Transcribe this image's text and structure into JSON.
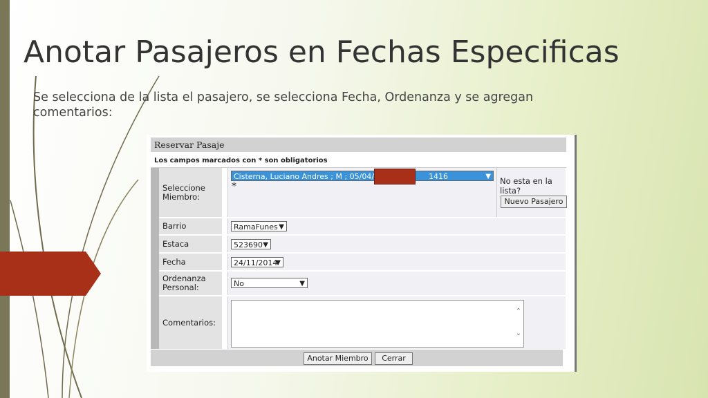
{
  "slide": {
    "title": "Anotar Pasajeros en Fechas Especificas",
    "body_line1": "Se selecciona de la lista el pasajero, se selecciona Fecha, Ordenanza y se agregan",
    "body_line2": "comentarios:"
  },
  "form": {
    "header": "Reservar Pasaje",
    "note": "Los campos marcados con * son obligatorios",
    "member": {
      "label": "Seleccione Miembro:",
      "value_left": "Cisterna, Luciano Andres ; M ; 05/04/1977 ;",
      "value_right": "1416",
      "required_mark": "*",
      "not_listed": "No esta en la lista?",
      "new_button": "Nuevo Pasajero"
    },
    "barrio": {
      "label": "Barrio",
      "value": "RamaFunes"
    },
    "estaca": {
      "label": "Estaca",
      "value": "523690"
    },
    "fecha": {
      "label": "Fecha",
      "value": "24/11/2014"
    },
    "ordenanza": {
      "label": "Ordenanza Personal:",
      "value": "No"
    },
    "comentarios": {
      "label": "Comentarios:",
      "value": ""
    },
    "buttons": {
      "submit": "Anotar Miembro",
      "cancel": "Cerrar"
    }
  },
  "colors": {
    "accent_red": "#a83018",
    "left_bar": "#7a7658",
    "select_highlight": "#3a92d8"
  },
  "icons": [
    "chevron-down-icon",
    "scroll-up-icon",
    "scroll-down-icon"
  ]
}
